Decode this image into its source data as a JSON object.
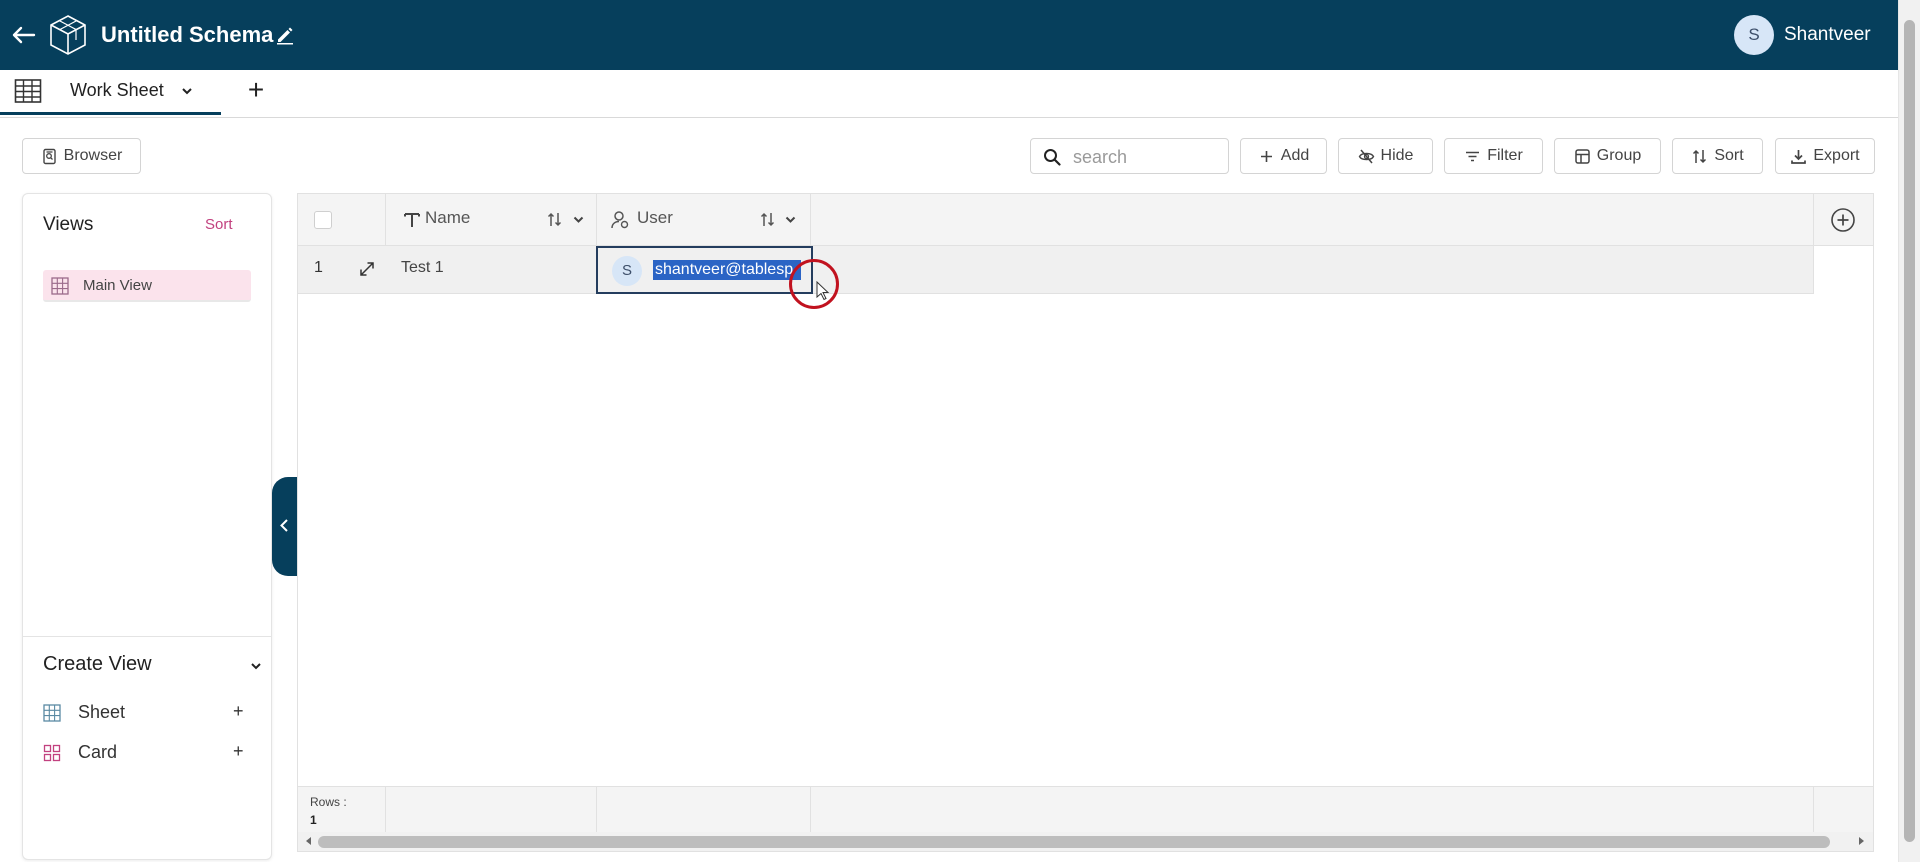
{
  "header": {
    "title": "Untitled Schema",
    "user_initial": "S",
    "user_name": "Shantveer"
  },
  "tabs": [
    {
      "label": "Work Sheet"
    }
  ],
  "toolbar": {
    "browser_label": "Browser",
    "search_placeholder": "search",
    "add_label": "Add",
    "hide_label": "Hide",
    "filter_label": "Filter",
    "group_label": "Group",
    "sort_label": "Sort",
    "export_label": "Export"
  },
  "views_panel": {
    "title": "Views",
    "sort_label": "Sort",
    "views": [
      {
        "label": "Main View"
      }
    ],
    "create_title": "Create View",
    "create_items": [
      {
        "label": "Sheet",
        "plus": "+"
      },
      {
        "label": "Card",
        "plus": "+"
      }
    ]
  },
  "grid": {
    "columns": [
      {
        "label": "Name",
        "icon": "text-type-icon"
      },
      {
        "label": "User",
        "icon": "user-icon"
      }
    ],
    "rows": [
      {
        "num": "1",
        "name": "Test 1",
        "user_initial": "S",
        "user_email": "shantveer@tablesp"
      }
    ],
    "footer_label": "Rows :",
    "footer_count": "1"
  },
  "colors": {
    "header_bg": "#063f5c",
    "accent_pink": "#c2417f",
    "selection_blue": "#2b64c5",
    "cursor_ring": "#c1121f"
  }
}
